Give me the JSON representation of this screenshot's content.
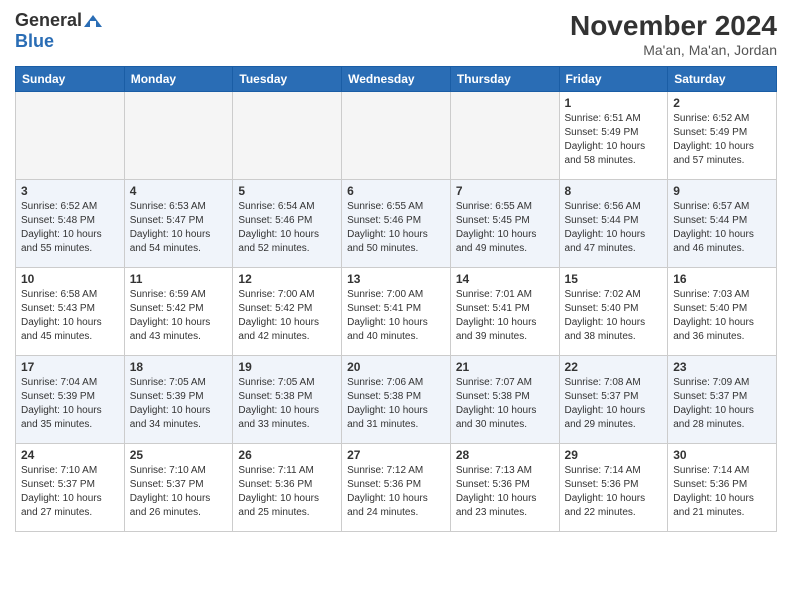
{
  "logo": {
    "general": "General",
    "blue": "Blue"
  },
  "header": {
    "month": "November 2024",
    "location": "Ma'an, Ma'an, Jordan"
  },
  "weekdays": [
    "Sunday",
    "Monday",
    "Tuesday",
    "Wednesday",
    "Thursday",
    "Friday",
    "Saturday"
  ],
  "weeks": [
    [
      {
        "day": "",
        "info": ""
      },
      {
        "day": "",
        "info": ""
      },
      {
        "day": "",
        "info": ""
      },
      {
        "day": "",
        "info": ""
      },
      {
        "day": "",
        "info": ""
      },
      {
        "day": "1",
        "info": "Sunrise: 6:51 AM\nSunset: 5:49 PM\nDaylight: 10 hours and 58 minutes."
      },
      {
        "day": "2",
        "info": "Sunrise: 6:52 AM\nSunset: 5:49 PM\nDaylight: 10 hours and 57 minutes."
      }
    ],
    [
      {
        "day": "3",
        "info": "Sunrise: 6:52 AM\nSunset: 5:48 PM\nDaylight: 10 hours and 55 minutes."
      },
      {
        "day": "4",
        "info": "Sunrise: 6:53 AM\nSunset: 5:47 PM\nDaylight: 10 hours and 54 minutes."
      },
      {
        "day": "5",
        "info": "Sunrise: 6:54 AM\nSunset: 5:46 PM\nDaylight: 10 hours and 52 minutes."
      },
      {
        "day": "6",
        "info": "Sunrise: 6:55 AM\nSunset: 5:46 PM\nDaylight: 10 hours and 50 minutes."
      },
      {
        "day": "7",
        "info": "Sunrise: 6:55 AM\nSunset: 5:45 PM\nDaylight: 10 hours and 49 minutes."
      },
      {
        "day": "8",
        "info": "Sunrise: 6:56 AM\nSunset: 5:44 PM\nDaylight: 10 hours and 47 minutes."
      },
      {
        "day": "9",
        "info": "Sunrise: 6:57 AM\nSunset: 5:44 PM\nDaylight: 10 hours and 46 minutes."
      }
    ],
    [
      {
        "day": "10",
        "info": "Sunrise: 6:58 AM\nSunset: 5:43 PM\nDaylight: 10 hours and 45 minutes."
      },
      {
        "day": "11",
        "info": "Sunrise: 6:59 AM\nSunset: 5:42 PM\nDaylight: 10 hours and 43 minutes."
      },
      {
        "day": "12",
        "info": "Sunrise: 7:00 AM\nSunset: 5:42 PM\nDaylight: 10 hours and 42 minutes."
      },
      {
        "day": "13",
        "info": "Sunrise: 7:00 AM\nSunset: 5:41 PM\nDaylight: 10 hours and 40 minutes."
      },
      {
        "day": "14",
        "info": "Sunrise: 7:01 AM\nSunset: 5:41 PM\nDaylight: 10 hours and 39 minutes."
      },
      {
        "day": "15",
        "info": "Sunrise: 7:02 AM\nSunset: 5:40 PM\nDaylight: 10 hours and 38 minutes."
      },
      {
        "day": "16",
        "info": "Sunrise: 7:03 AM\nSunset: 5:40 PM\nDaylight: 10 hours and 36 minutes."
      }
    ],
    [
      {
        "day": "17",
        "info": "Sunrise: 7:04 AM\nSunset: 5:39 PM\nDaylight: 10 hours and 35 minutes."
      },
      {
        "day": "18",
        "info": "Sunrise: 7:05 AM\nSunset: 5:39 PM\nDaylight: 10 hours and 34 minutes."
      },
      {
        "day": "19",
        "info": "Sunrise: 7:05 AM\nSunset: 5:38 PM\nDaylight: 10 hours and 33 minutes."
      },
      {
        "day": "20",
        "info": "Sunrise: 7:06 AM\nSunset: 5:38 PM\nDaylight: 10 hours and 31 minutes."
      },
      {
        "day": "21",
        "info": "Sunrise: 7:07 AM\nSunset: 5:38 PM\nDaylight: 10 hours and 30 minutes."
      },
      {
        "day": "22",
        "info": "Sunrise: 7:08 AM\nSunset: 5:37 PM\nDaylight: 10 hours and 29 minutes."
      },
      {
        "day": "23",
        "info": "Sunrise: 7:09 AM\nSunset: 5:37 PM\nDaylight: 10 hours and 28 minutes."
      }
    ],
    [
      {
        "day": "24",
        "info": "Sunrise: 7:10 AM\nSunset: 5:37 PM\nDaylight: 10 hours and 27 minutes."
      },
      {
        "day": "25",
        "info": "Sunrise: 7:10 AM\nSunset: 5:37 PM\nDaylight: 10 hours and 26 minutes."
      },
      {
        "day": "26",
        "info": "Sunrise: 7:11 AM\nSunset: 5:36 PM\nDaylight: 10 hours and 25 minutes."
      },
      {
        "day": "27",
        "info": "Sunrise: 7:12 AM\nSunset: 5:36 PM\nDaylight: 10 hours and 24 minutes."
      },
      {
        "day": "28",
        "info": "Sunrise: 7:13 AM\nSunset: 5:36 PM\nDaylight: 10 hours and 23 minutes."
      },
      {
        "day": "29",
        "info": "Sunrise: 7:14 AM\nSunset: 5:36 PM\nDaylight: 10 hours and 22 minutes."
      },
      {
        "day": "30",
        "info": "Sunrise: 7:14 AM\nSunset: 5:36 PM\nDaylight: 10 hours and 21 minutes."
      }
    ]
  ]
}
